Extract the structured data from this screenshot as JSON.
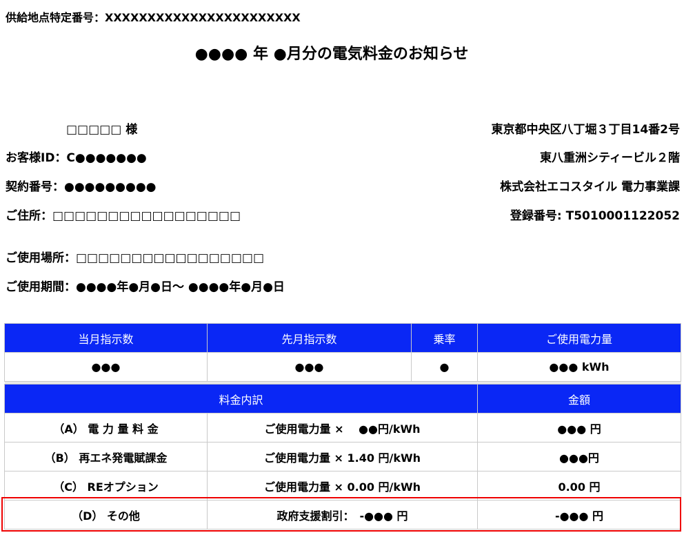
{
  "header": {
    "supply_point": "供給地点特定番号：XXXXXXXXXXXXXXXXXXXXXXX",
    "title": "●●●● 年 ●月分の電気料金のお知らせ"
  },
  "customer": {
    "name": "□□□□□ 様",
    "customer_id": "お客様ID：C●●●●●●●",
    "contract_no": "契約番号：●●●●●●●●●",
    "address": "ご住所：□□□□□□□□□□□□□□□□□",
    "usage_place": "ご使用場所：□□□□□□□□□□□□□□□□□",
    "usage_period": "ご使用期間：●●●●年●月●日～ ●●●●年●月●日"
  },
  "company": {
    "address1": "東京都中央区八丁堀３丁目14番2号",
    "address2": "東八重洲シティービル２階",
    "name": "株式会社エコスタイル 電力事業課",
    "registration": "登録番号: T5010001122052"
  },
  "meter": {
    "headers": [
      "当月指示数",
      "先月指示数",
      "乗率",
      "ご使用電力量"
    ],
    "values": [
      "●●●",
      "●●●",
      "●",
      "●●● kWh"
    ]
  },
  "breakdown": {
    "header_item": "料金内訳",
    "header_amount": "金額",
    "rows": [
      {
        "label": "（A） 電 力 量 料 金",
        "detail": "ご使用電力量 ×　 ●●円/kWh",
        "amount": "●●● 円"
      },
      {
        "label": "（B） 再エネ発電賦課金",
        "detail": "ご使用電力量 × 1.40 円/kWh",
        "amount": "●●●円"
      },
      {
        "label": "（C） REオプション",
        "detail": "ご使用電力量 × 0.00 円/kWh",
        "amount": "0.00 円"
      },
      {
        "label": "（D） その他",
        "detail": "政府支援割引：　-●●● 円",
        "amount": "-●●● 円"
      }
    ]
  },
  "highlight_color": "#ee0000",
  "accent_color": "#0a27f5"
}
